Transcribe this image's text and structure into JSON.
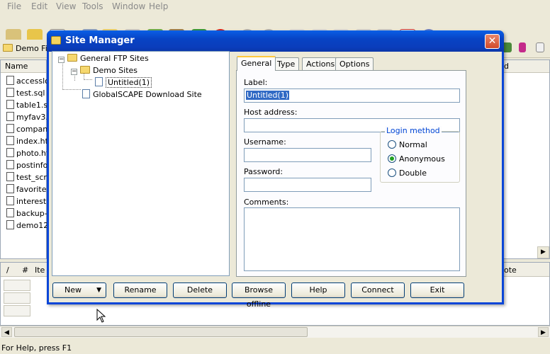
{
  "menu": [
    "File",
    "Edit",
    "View",
    "Tools",
    "Window",
    "Help"
  ],
  "address_bar": {
    "label": "Demo Fil"
  },
  "left_pane": {
    "header": "Name",
    "files": [
      "accesslo",
      "test.sql",
      "table1.s",
      "myfav3.",
      "company",
      "index.ht",
      "photo.ht",
      "postinfo",
      "test_scri",
      "favorite.",
      "interest.",
      "backup-f",
      "demo12"
    ]
  },
  "right_strip": {
    "header": "d"
  },
  "queue": {
    "columns": [
      "/",
      "#",
      "Ite",
      "ote"
    ]
  },
  "status_bar": {
    "text": "For Help, press F1"
  },
  "dialog": {
    "title": "Site Manager",
    "close": "✕",
    "tree": {
      "root": "General FTP Sites",
      "folder": "Demo Sites",
      "item": "Untitled(1)",
      "other": "GlobalSCAPE Download Site"
    },
    "tabs": [
      "General",
      "Type",
      "Actions",
      "Options"
    ],
    "general": {
      "label_caption": "Label:",
      "label_value": "Untitled(1)",
      "host_caption": "Host address:",
      "host_value": "",
      "username_caption": "Username:",
      "username_value": "",
      "password_caption": "Password:",
      "password_value": "",
      "login_method": {
        "legend": "Login method",
        "options": [
          "Normal",
          "Anonymous",
          "Double"
        ],
        "selected": "Anonymous"
      },
      "comments_caption": "Comments:"
    },
    "buttons": {
      "new": "New",
      "rename": "Rename",
      "delete": "Delete",
      "browse_offline": "Browse offline",
      "help": "Help",
      "connect": "Connect",
      "exit": "Exit"
    }
  },
  "colors": {
    "title_bar": "#0a46d8",
    "selection": "#316ac5",
    "checked_radio": "#21a121"
  }
}
